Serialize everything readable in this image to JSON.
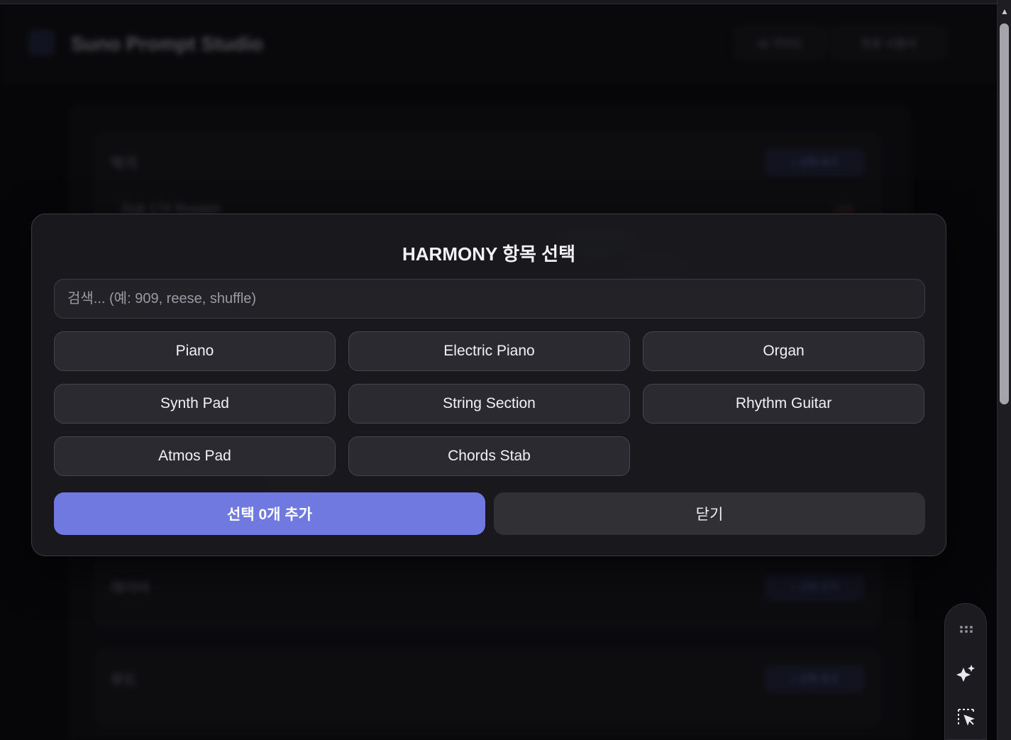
{
  "background": {
    "app_title": "Suno Prompt Studio",
    "header_buttons": [
      "AI 가이드",
      "프로 시퀀서"
    ],
    "cards": [
      {
        "label": "악기",
        "button": "+ 선택 추가",
        "row": "Dub 174 Stuepps",
        "row_tag": "삭제"
      },
      {
        "label": "레이어",
        "button": "+ 선택 추가"
      },
      {
        "label": "무드",
        "button": "+ 선택 추가"
      }
    ]
  },
  "modal": {
    "title": "HARMONY 항목 선택",
    "search": {
      "value": "",
      "placeholder": "검색... (예: 909, reese, shuffle)"
    },
    "options": [
      {
        "label": "Piano"
      },
      {
        "label": "Electric Piano"
      },
      {
        "label": "Organ"
      },
      {
        "label": "Synth Pad"
      },
      {
        "label": "String Section"
      },
      {
        "label": "Rhythm Guitar"
      },
      {
        "label": "Atmos Pad"
      },
      {
        "label": "Chords Stab"
      }
    ],
    "add_button": "선택 0개 추가",
    "close_button": "닫기"
  },
  "toolbar": {
    "icons": [
      "grip-dots-icon",
      "sparkle-icon",
      "select-cursor-icon"
    ]
  },
  "colors": {
    "accent": "#6f79e0",
    "background": "#060608",
    "modal": "#1a1a1e"
  }
}
